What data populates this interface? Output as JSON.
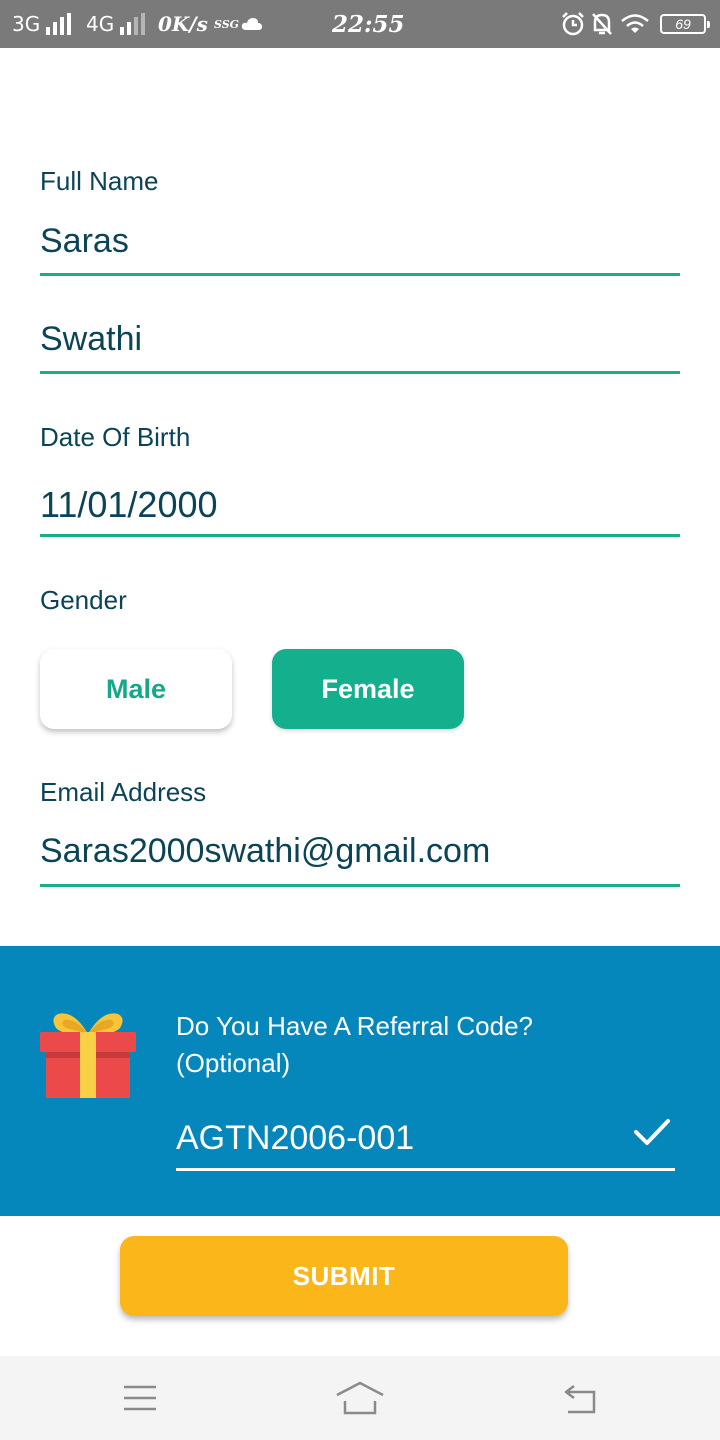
{
  "status_bar": {
    "network_1": "3G",
    "network_2": "4G",
    "speed": "0K/s",
    "extra": "SSG",
    "time": "22:55",
    "battery": "69"
  },
  "form": {
    "full_name_label": "Full Name",
    "first_name_value": "Saras",
    "last_name_value": "Swathi",
    "dob_label": "Date Of Birth",
    "dob_value": "11/01/2000",
    "gender_label": "Gender",
    "gender_options": [
      "Male",
      "Female"
    ],
    "gender_selected": "Female",
    "email_label": "Email Address",
    "email_value": "Saras2000swathi@gmail.com"
  },
  "referral": {
    "question_line1": "Do You Have A Referral Code?",
    "question_line2": "(Optional)",
    "code_value": "AGTN2006-001",
    "icon": "gift-icon",
    "status_icon": "checkmark-icon"
  },
  "submit_label": "SUBMIT",
  "navbar": {
    "icons": [
      "menu-icon",
      "home-icon",
      "back-icon"
    ]
  },
  "colors": {
    "accent": "#19ad8a",
    "text": "#0b4457",
    "referral_bg": "#0587bb",
    "submit_bg": "#fbb71a"
  }
}
